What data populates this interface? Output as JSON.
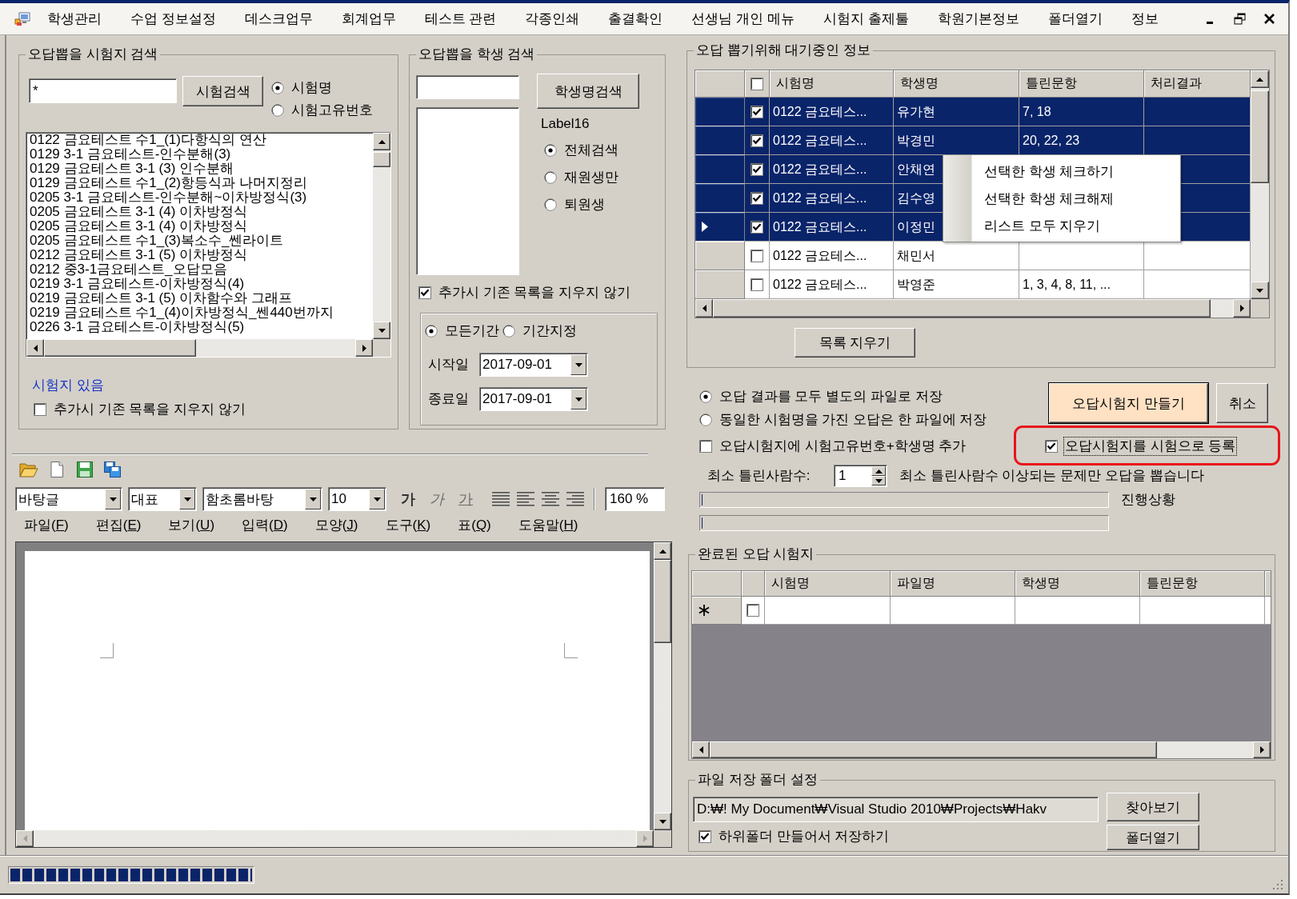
{
  "menu_bar": {
    "items": [
      "학생관리",
      "수업 정보설정",
      "데스크업무",
      "회계업무",
      "테스트 관련",
      "각종인쇄",
      "출결확인",
      "선생님 개인 메뉴",
      "시험지 출제툴",
      "학원기본정보",
      "폴더열기",
      "정보"
    ]
  },
  "exam_search": {
    "title": "오답뽑을 시험지 검색",
    "query": "*",
    "search_button": "시험검색",
    "search_by": [
      {
        "label": "시험명",
        "selected": true
      },
      {
        "label": "시험고유번호",
        "selected": false
      }
    ],
    "exams": [
      {
        "label": "0122 금요테스트 수1_(1)다항식의 연산",
        "selected": false
      },
      {
        "label": "0129 3-1 금요테스트-인수분해(3)",
        "selected": false
      },
      {
        "label": "0129 금요테스트 3-1 (3) 인수분해",
        "selected": false
      },
      {
        "label": "0129 금요테스트 수1_(2)항등식과 나머지정리",
        "selected": false
      },
      {
        "label": "0205 3-1 금요테스트-인수분해~이차방정식(3)",
        "selected": false
      },
      {
        "label": "0205 금요테스트 3-1 (4) 이차방정식",
        "selected": false
      },
      {
        "label": "0205 금요테스트 3-1 (4) 이차방정식",
        "selected": false
      },
      {
        "label": "0205 금요테스트 수1_(3)복소수_쎈라이트",
        "selected": false
      },
      {
        "label": "0212 금요테스트 3-1 (5) 이차방정식",
        "selected": false
      },
      {
        "label": "0212 중3-1금요테스트_오답모음",
        "selected": false
      },
      {
        "label": "0219 3-1 금요테스트-이차방정식(4)",
        "selected": false
      },
      {
        "label": "0219 금요테스트 3-1 (5) 이차함수와 그래프",
        "selected": false
      },
      {
        "label": "0219 금요테스트 수1_(4)이차방정식_쎈440번까지",
        "selected": false
      },
      {
        "label": "0226 3-1 금요테스트-이차방정식(5)",
        "selected": false
      }
    ],
    "status": "시험지 있음",
    "keep_list": {
      "label": "추가시 기존 목록을 지우지 않기",
      "checked": false
    }
  },
  "student_search": {
    "title": "오답뽑을 학생 검색",
    "search_button": "학생명검색",
    "label": "Label16",
    "filter": [
      {
        "label": "전체검색",
        "selected": true
      },
      {
        "label": "재원생만",
        "selected": false
      },
      {
        "label": "퇴원생",
        "selected": false
      }
    ],
    "keep_list": {
      "label": "추가시 기존 목록을 지우지 않기",
      "checked": true
    },
    "period": [
      {
        "label": "모든기간",
        "selected": true
      },
      {
        "label": "기간지정",
        "selected": false
      }
    ],
    "dates": [
      {
        "label": "시작일",
        "value": "2017-09-01"
      },
      {
        "label": "종료일",
        "value": "2017-09-01"
      }
    ]
  },
  "editor": {
    "dropdowns": [
      {
        "value": "바탕글"
      },
      {
        "value": "대표"
      },
      {
        "value": "함초롬바탕"
      },
      {
        "value": "10"
      }
    ],
    "format_buttons": [
      {
        "text": "가",
        "kind": "bold"
      },
      {
        "text": "가",
        "kind": "italic"
      },
      {
        "text": "가",
        "kind": "underline"
      }
    ],
    "zoom": "160 %",
    "menu": [
      {
        "before": "파일(",
        "key": "F",
        "after": ")"
      },
      {
        "before": "편집(",
        "key": "E",
        "after": ")"
      },
      {
        "before": "보기(",
        "key": "U",
        "after": ")"
      },
      {
        "before": "입력(",
        "key": "D",
        "after": ")"
      },
      {
        "before": "모양(",
        "key": "J",
        "after": ")"
      },
      {
        "before": "도구(",
        "key": "K",
        "after": ")"
      },
      {
        "before": "표(",
        "key": "Q",
        "after": ")"
      },
      {
        "before": "도움말(",
        "key": "H",
        "after": ")"
      }
    ]
  },
  "waiting": {
    "title": "오답 뽑기위해 대기중인 정보",
    "header_checked": false,
    "columns": [
      {
        "label": "시험명"
      },
      {
        "label": "학생명"
      },
      {
        "label": "틀린문항"
      },
      {
        "label": "처리결과"
      }
    ],
    "rows": [
      {
        "selected": true,
        "current": false,
        "checked": true,
        "exam": "0122 금요테스...",
        "student": "유가현",
        "wrong": "7, 18"
      },
      {
        "selected": true,
        "current": false,
        "checked": true,
        "exam": "0122 금요테스...",
        "student": "박경민",
        "wrong": "20, 22, 23"
      },
      {
        "selected": true,
        "current": false,
        "checked": true,
        "exam": "0122 금요테스...",
        "student": "안채연"
      },
      {
        "selected": true,
        "current": false,
        "checked": true,
        "exam": "0122 금요테스...",
        "student": "김수영"
      },
      {
        "selected": true,
        "current": true,
        "checked": true,
        "exam": "0122 금요테스...",
        "student": "이정민"
      },
      {
        "selected": false,
        "current": false,
        "checked": false,
        "exam": "0122 금요테스...",
        "student": "채민서"
      },
      {
        "selected": false,
        "current": false,
        "checked": false,
        "exam": "0122 금요테스...",
        "student": "박영준",
        "wrong": "1, 3, 4, 8, 11, ..."
      }
    ],
    "context_menu": {
      "items": [
        "선택한 학생 체크하기",
        "선택한 학생 체크해제",
        "리스트 모두 지우기"
      ]
    },
    "clear_button": "목록 지우기"
  },
  "options": {
    "save_mode": [
      {
        "label": "오답 결과를 모두 별도의 파일로 저장",
        "selected": true
      },
      {
        "label": "동일한 시험명을 가진 오답은 한 파일에 저장",
        "selected": false
      }
    ],
    "make_button": "오답시험지 만들기",
    "cancel_button": "취소",
    "add_id": {
      "label": "오답시험지에 시험고유번호+학생명 추가",
      "checked": false
    },
    "register": {
      "label": "오답시험지를 시험으로 등록",
      "checked": true,
      "focused": true,
      "highlighted": true
    },
    "min_wrong": {
      "label": "최소 틀린사람수:",
      "value": "1",
      "note": "최소 틀린사람수 이상되는 문제만 오답을 뽑습니다"
    },
    "progress": [
      {
        "label": "진행상황",
        "level": 0
      },
      {
        "level": 0
      }
    ]
  },
  "done": {
    "title": "완료된 오답 시험지",
    "columns": [
      {
        "label": "시험명"
      },
      {
        "label": "파일명"
      },
      {
        "label": "학생명"
      },
      {
        "label": "틀린문항"
      }
    ],
    "new_row": {
      "checked": false
    }
  },
  "folder": {
    "title": "파일 저장 폴더 설정",
    "path": "D:₩! My Document₩Visual Studio 2010₩Projects₩Hakv",
    "browse_button": "찾아보기",
    "open_button": "폴더열기",
    "subfolder": {
      "label": "하위폴더 만들어서 저장하기",
      "checked": true
    }
  },
  "status_bar": {
    "progress": {
      "level": 1
    }
  }
}
